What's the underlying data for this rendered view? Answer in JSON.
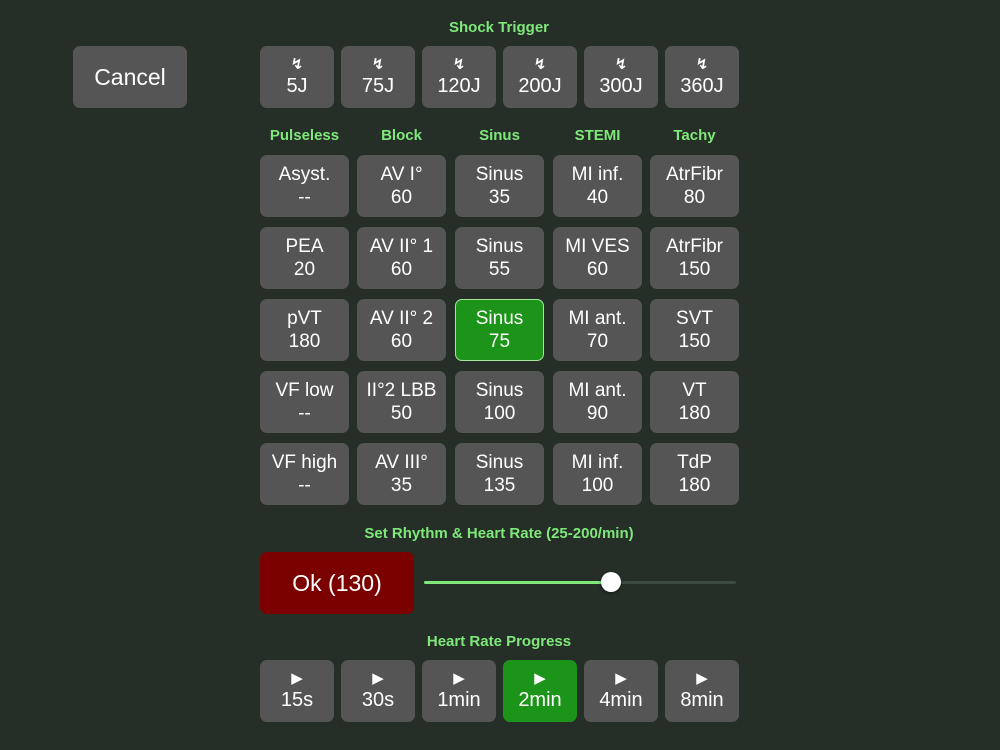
{
  "cancel_label": "Cancel",
  "shock": {
    "title": "Shock Trigger",
    "icon": "lightning-bolt",
    "glyph": "↯",
    "buttons": [
      "5J",
      "75J",
      "120J",
      "200J",
      "300J",
      "360J"
    ]
  },
  "rhythms": {
    "columns": [
      "Pulseless",
      "Block",
      "Sinus",
      "STEMI",
      "Tachy"
    ],
    "grid": [
      [
        {
          "name": "Asyst.",
          "rate": "--"
        },
        {
          "name": "PEA",
          "rate": "20"
        },
        {
          "name": "pVT",
          "rate": "180"
        },
        {
          "name": "VF low",
          "rate": "--"
        },
        {
          "name": "VF high",
          "rate": "--"
        }
      ],
      [
        {
          "name": "AV I°",
          "rate": "60"
        },
        {
          "name": "AV II° 1",
          "rate": "60"
        },
        {
          "name": "AV II° 2",
          "rate": "60"
        },
        {
          "name": "II°2 LBB",
          "rate": "50"
        },
        {
          "name": "AV III°",
          "rate": "35"
        }
      ],
      [
        {
          "name": "Sinus",
          "rate": "35"
        },
        {
          "name": "Sinus",
          "rate": "55"
        },
        {
          "name": "Sinus",
          "rate": "75"
        },
        {
          "name": "Sinus",
          "rate": "100"
        },
        {
          "name": "Sinus",
          "rate": "135"
        }
      ],
      [
        {
          "name": "MI inf.",
          "rate": "40"
        },
        {
          "name": "MI VES",
          "rate": "60"
        },
        {
          "name": "MI ant.",
          "rate": "70"
        },
        {
          "name": "MI ant.",
          "rate": "90"
        },
        {
          "name": "MI inf.",
          "rate": "100"
        }
      ],
      [
        {
          "name": "AtrFibr",
          "rate": "80"
        },
        {
          "name": "AtrFibr",
          "rate": "150"
        },
        {
          "name": "SVT",
          "rate": "150"
        },
        {
          "name": "VT",
          "rate": "180"
        },
        {
          "name": "TdP",
          "rate": "180"
        }
      ]
    ],
    "selected": {
      "column": 2,
      "row": 2
    }
  },
  "heart_rate": {
    "label": "Set Rhythm & Heart Rate (25-200/min)",
    "ok_label": "Ok (130)",
    "min": 25,
    "max": 200,
    "value": 130
  },
  "progress": {
    "title": "Heart Rate Progress",
    "icon": "play-triangle",
    "glyph": "▶",
    "buttons": [
      "15s",
      "30s",
      "1min",
      "2min",
      "4min",
      "8min"
    ],
    "selected_index": 3
  },
  "colors": {
    "background": "#252e27",
    "button": "#555555",
    "label_green": "#7fe87a",
    "selected_green": "#1c9419",
    "ok_red": "#7b0000"
  }
}
